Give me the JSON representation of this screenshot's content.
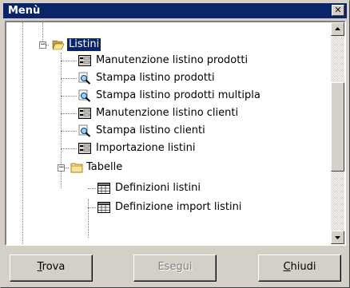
{
  "window": {
    "title": "Menù",
    "close_icon": "close-icon"
  },
  "tree": {
    "root": {
      "label": "Listini",
      "icon": "folder-open-icon",
      "expanded": true,
      "selected": true
    },
    "items": [
      {
        "label": "Manutenzione listino prodotti",
        "icon": "form-icon"
      },
      {
        "label": "Stampa listino prodotti",
        "icon": "print-preview-icon"
      },
      {
        "label": "Stampa listino prodotti multipla",
        "icon": "print-preview-icon"
      },
      {
        "label": "Manutenzione listino clienti",
        "icon": "form-icon"
      },
      {
        "label": "Stampa listino clienti",
        "icon": "print-preview-icon"
      },
      {
        "label": "Importazione listini",
        "icon": "form-icon"
      }
    ],
    "subfolder": {
      "label": "Tabelle",
      "icon": "folder-closed-icon",
      "expanded": true,
      "items": [
        {
          "label": "Definizioni listini",
          "icon": "grid-icon"
        },
        {
          "label": "Definizione import listini",
          "icon": "grid-icon"
        }
      ]
    }
  },
  "buttons": {
    "find": {
      "mnemonic": "T",
      "rest": "rova",
      "enabled": true
    },
    "run": {
      "label": "Esegui",
      "enabled": false
    },
    "close": {
      "mnemonic": "C",
      "rest": "hiudi",
      "enabled": true
    }
  },
  "colors": {
    "selection": "#0a246a",
    "titlebar": "#0a246a",
    "face": "#d4d0c8"
  }
}
